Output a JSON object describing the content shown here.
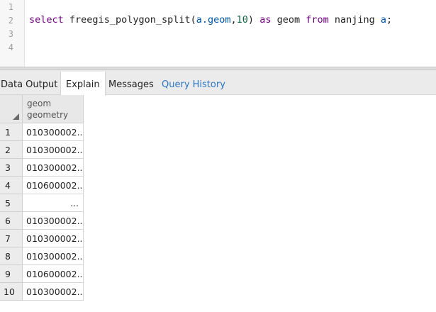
{
  "editor": {
    "line_numbers": [
      "1",
      "2",
      "3",
      "4"
    ],
    "code": {
      "kw_select": "select",
      "fn_name": "freegis_polygon_split(",
      "arg_alias": "a",
      "arg_dot_geom": ".geom",
      "comma": ",",
      "num_arg": "10",
      "close_paren": ") ",
      "kw_as": "as",
      "col_alias": " geom ",
      "kw_from": "from",
      "table": " nanjing ",
      "table_alias": "a",
      "semicolon": ";"
    }
  },
  "tabs": {
    "data_output": "Data Output",
    "explain": "Explain",
    "messages": "Messages",
    "query_history": "Query History"
  },
  "grid": {
    "column": {
      "name": "geom",
      "type": "geometry"
    },
    "rows": [
      {
        "no": "1",
        "value": "010300002..."
      },
      {
        "no": "2",
        "value": "010300002..."
      },
      {
        "no": "3",
        "value": "010300002..."
      },
      {
        "no": "4",
        "value": "010600002..."
      },
      {
        "no": "5",
        "value": "..."
      },
      {
        "no": "6",
        "value": "010300002..."
      },
      {
        "no": "7",
        "value": "010300002..."
      },
      {
        "no": "8",
        "value": "010300002..."
      },
      {
        "no": "9",
        "value": "010600002..."
      },
      {
        "no": "10",
        "value": "010300002..."
      }
    ]
  },
  "colors": {
    "keyword": "#770088",
    "variable": "#0055aa",
    "number": "#116644",
    "link_tab": "#2c76c7"
  }
}
